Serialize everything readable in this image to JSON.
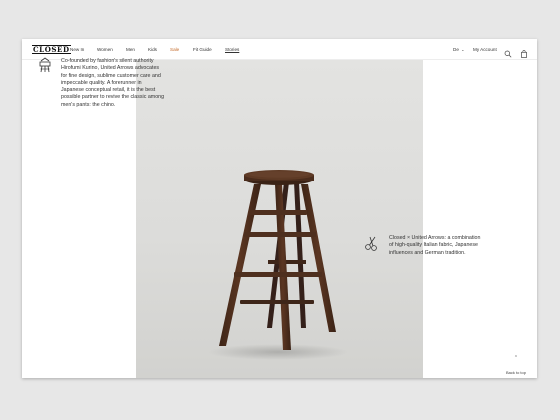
{
  "header": {
    "logo": "CLOSED",
    "nav": [
      {
        "label": "New In"
      },
      {
        "label": "Women"
      },
      {
        "label": "Men"
      },
      {
        "label": "Kids"
      },
      {
        "label": "Sale"
      },
      {
        "label": "Fit Guide"
      },
      {
        "label": "Stories"
      }
    ],
    "language": "De",
    "account": "My Account",
    "icons": [
      "chevron-down-icon",
      "search-icon",
      "shopping-bag-icon"
    ]
  },
  "content": {
    "intro_text": "Co-founded by fashion's silent authority Hirofumi Kurino, United Arrows advocates for fine design, sublime customer care and impeccable quality. A forerunner in Japanese conceptual retail, it is the best possible partner to revive the classic among men's pants: the chino.",
    "collab_text": "Closed × United Arrows: a combination of high-quality Italian fabric, Japanese influences and German tradition.",
    "icons": [
      "united-arrows-mark-icon",
      "scissors-icon"
    ]
  },
  "footer": {
    "back_to_top": "Back to top",
    "icon": "arrow-up-icon"
  },
  "colors": {
    "sale": "#c46a2a",
    "background": "#e7e7e7",
    "photo_bg": "#dcdcda",
    "wood": "#4a2c1c"
  }
}
